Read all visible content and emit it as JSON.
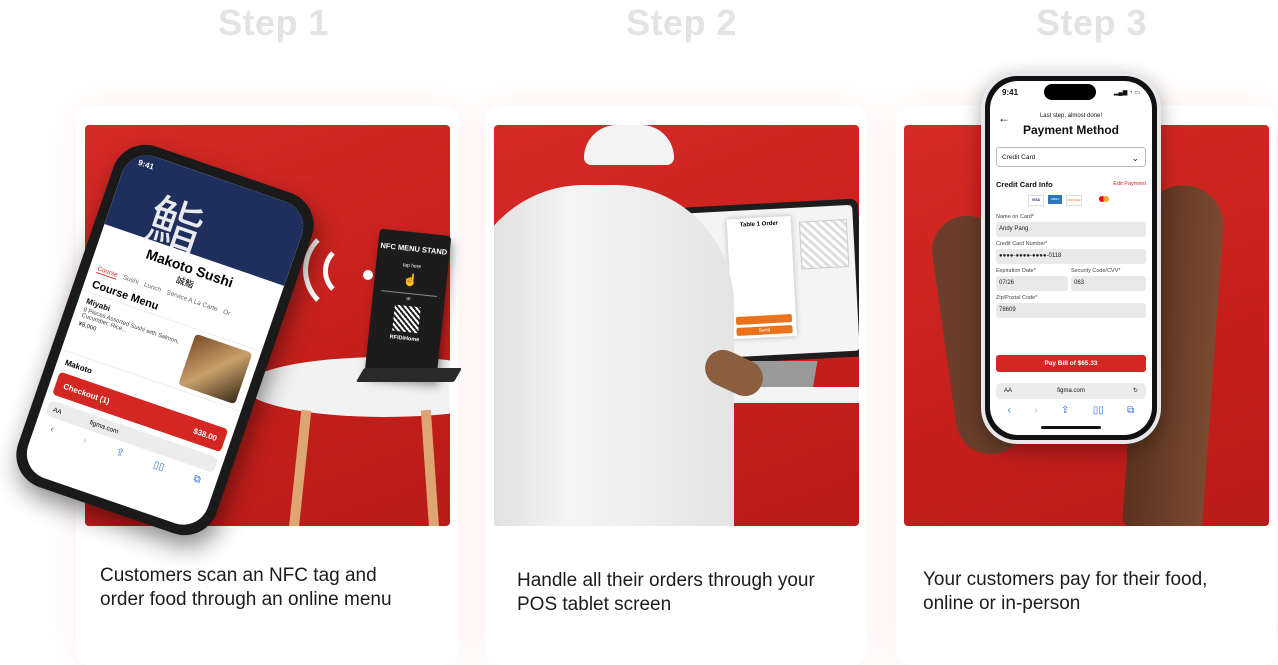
{
  "steps": [
    {
      "title": "Step 1",
      "caption_line1": "Customers scan an NFC tag and",
      "caption_line2": "order food through an online menu"
    },
    {
      "title": "Step 2",
      "caption_line1": "Handle all their orders through your",
      "caption_line2": "POS tablet screen"
    },
    {
      "title": "Step 3",
      "caption_line1": "Your customers pay for their food,",
      "caption_line2": "online or in-person"
    }
  ],
  "menu_phone": {
    "time": "9:41",
    "restaurant": "Makoto Sushi",
    "restaurant_jp": "誠鮨",
    "tabs": [
      "Course",
      "Sushi",
      "Lunch",
      "Service A La Carte",
      "Or"
    ],
    "section": "Course Menu",
    "item_name": "Miyabi",
    "item_desc": "8 Pieces Assorted Sushi with Salmon, Cucumber, Rice...",
    "item_price": "¥8,000",
    "item2_name": "Makoto",
    "checkout": "Checkout (1)",
    "total": "$38.00",
    "url": "figma.com",
    "aa": "AA"
  },
  "nfc_stand": {
    "title": "NFC MENU STAND",
    "tap": "tap here",
    "or": "or",
    "brand": "RFIDiHome"
  },
  "tablet": {
    "title": "Table 1 Order",
    "button": "Send"
  },
  "payment_phone": {
    "time": "9:41",
    "subtitle": "Last step, almost done!",
    "title": "Payment Method",
    "method": "Credit Card",
    "section": "Credit Card Info",
    "edit": "Edit Payment",
    "cards": [
      "VISA",
      "AMEX",
      "DISCOVER",
      "MC"
    ],
    "name_label": "Name on Card*",
    "name_value": "Andy Pang",
    "number_label": "Credit Card Number*",
    "number_value": "●●●●-●●●●-●●●●-0118",
    "exp_label": "Expiration Date*",
    "exp_value": "07/26",
    "cvv_label": "Security Code/CVV*",
    "cvv_value": "063",
    "zip_label": "Zip/Postal Code*",
    "zip_value": "78609",
    "pay_button": "Pay Bill of $65.33",
    "aa": "AA",
    "url": "figma.com"
  },
  "colors": {
    "brand_red": "#d42724",
    "step_title": "#e3e3e3"
  }
}
